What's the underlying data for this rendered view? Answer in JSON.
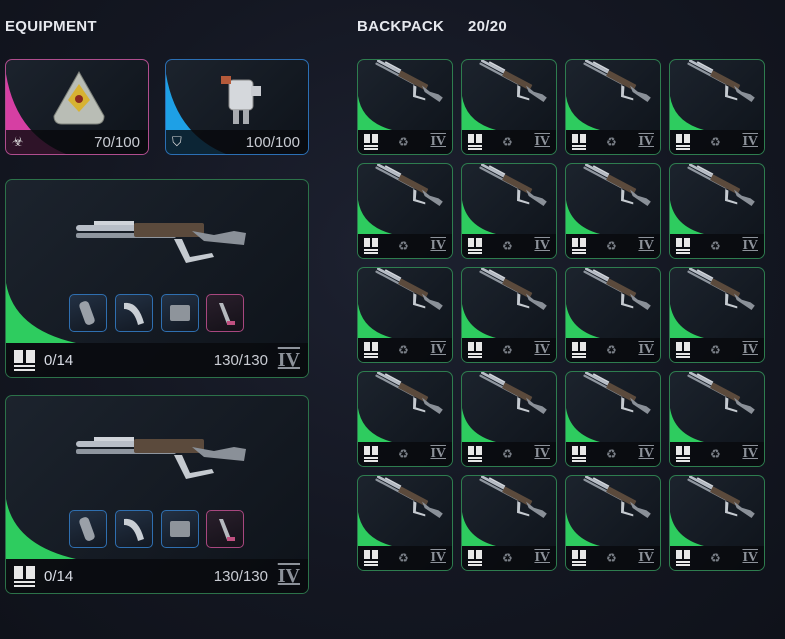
{
  "equipment": {
    "title": "EQUIPMENT",
    "armor": {
      "value": "70/100",
      "icon": "biohazard-icon",
      "accent": "#d63fa3"
    },
    "helmet": {
      "value": "100/100",
      "icon": "shield-icon",
      "accent": "#1ea0e6"
    },
    "weapons": [
      {
        "ammo": "0/14",
        "durability": "130/130",
        "tier": "IV",
        "attachments": [
          "barrel-icon",
          "stock-icon",
          "magazine-icon",
          "scope-icon"
        ]
      },
      {
        "ammo": "0/14",
        "durability": "130/130",
        "tier": "IV",
        "attachments": [
          "barrel-icon",
          "stock-icon",
          "magazine-icon",
          "scope-icon"
        ]
      }
    ]
  },
  "backpack": {
    "title": "BACKPACK",
    "count": "20/20",
    "item_tier": "IV",
    "accent": "#2ecc5f",
    "items": 20
  }
}
